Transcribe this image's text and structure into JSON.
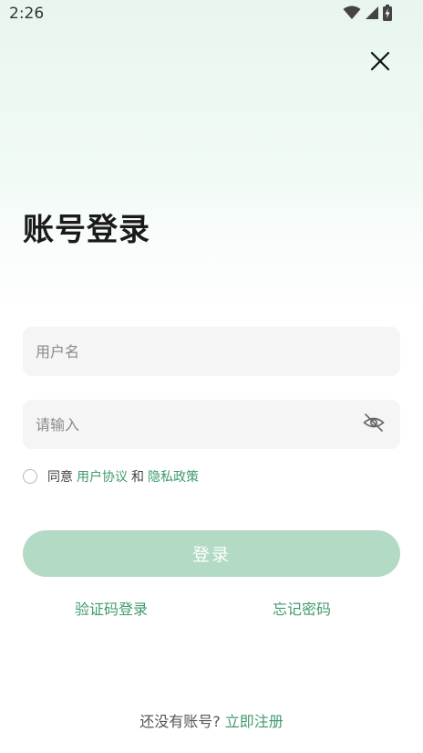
{
  "status_bar": {
    "time": "2:26",
    "icons": [
      "wifi-icon",
      "signal-icon",
      "battery-charging-icon"
    ]
  },
  "header": {
    "close_icon": "close-icon"
  },
  "page": {
    "title": "账号登录"
  },
  "form": {
    "username_placeholder": "用户名",
    "username_value": "",
    "password_placeholder": "请输入",
    "password_value": "",
    "password_toggle_icon": "eye-off-icon"
  },
  "agreement": {
    "prefix": "同意",
    "user_agreement": "用户协议",
    "conjunction": "和",
    "privacy_policy": "隐私政策",
    "checked": false
  },
  "actions": {
    "login_label": "登录",
    "sms_login_label": "验证码登录",
    "forgot_password_label": "忘记密码"
  },
  "footer": {
    "no_account_text": "还没有账号?",
    "register_label": "立即注册"
  },
  "colors": {
    "accent": "#3f9a6f",
    "login_button_bg": "#b2dac5",
    "input_bg": "#f5f5f5"
  }
}
